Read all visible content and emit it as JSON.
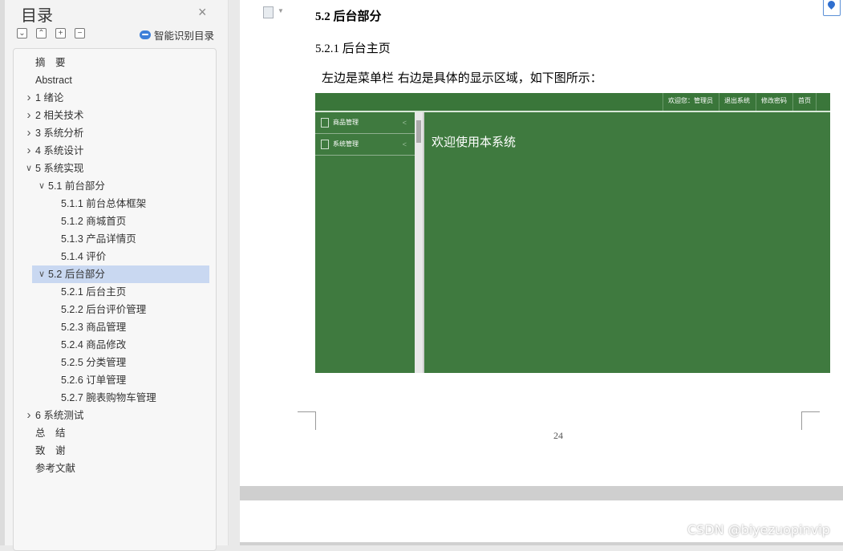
{
  "toc": {
    "title": "目录",
    "close": "×",
    "toolbar": {
      "collapse": "⌄",
      "expand": "⌃",
      "add": "+",
      "remove": "−"
    },
    "smart_label": "智能识别目录",
    "items": [
      {
        "label": "摘　要",
        "arrow": "",
        "level": 0
      },
      {
        "label": "Abstract",
        "arrow": "",
        "level": 0
      },
      {
        "label": "1 绪论",
        "arrow": ">",
        "level": 0
      },
      {
        "label": "2 相关技术",
        "arrow": ">",
        "level": 0
      },
      {
        "label": "3 系统分析",
        "arrow": ">",
        "level": 0
      },
      {
        "label": "4 系统设计",
        "arrow": ">",
        "level": 0
      },
      {
        "label": "5 系统实现",
        "arrow": "v",
        "level": 0
      },
      {
        "label": "5.1  前台部分",
        "arrow": "v",
        "level": 1
      },
      {
        "label": "5.1.1  前台总体框架",
        "arrow": "",
        "level": 2
      },
      {
        "label": "5.1.2  商城首页",
        "arrow": "",
        "level": 2
      },
      {
        "label": "5.1.3  产品详情页",
        "arrow": "",
        "level": 2
      },
      {
        "label": "5.1.4  评价",
        "arrow": "",
        "level": 2
      },
      {
        "label": "5.2  后台部分",
        "arrow": "v",
        "level": 1,
        "selected": true
      },
      {
        "label": "5.2.1  后台主页",
        "arrow": "",
        "level": 2
      },
      {
        "label": "5.2.2  后台评价管理",
        "arrow": "",
        "level": 2
      },
      {
        "label": "5.2.3  商品管理",
        "arrow": "",
        "level": 2
      },
      {
        "label": "5.2.4  商品修改",
        "arrow": "",
        "level": 2
      },
      {
        "label": "5.2.5  分类管理",
        "arrow": "",
        "level": 2
      },
      {
        "label": "5.2.6  订单管理",
        "arrow": "",
        "level": 2
      },
      {
        "label": "5.2.7  腕表购物车管理",
        "arrow": "",
        "level": 2
      },
      {
        "label": "6 系统测试",
        "arrow": ">",
        "level": 0
      },
      {
        "label": "总　结",
        "arrow": "",
        "level": 0
      },
      {
        "label": "致　谢",
        "arrow": "",
        "level": 0
      },
      {
        "label": "参考文献",
        "arrow": "",
        "level": 0
      }
    ]
  },
  "document": {
    "heading2": "5.2  后台部分",
    "heading3": "5.2.1  后台主页",
    "paragraph": "左边是菜单栏  右边是具体的显示区域，如下图所示：",
    "page_number": "24"
  },
  "screenshot": {
    "nav": [
      "欢迎您：管理员",
      "退出系统",
      "修改密码",
      "首页"
    ],
    "menu": [
      "商品管理",
      "系统管理"
    ],
    "welcome": "欢迎使用本系统",
    "colors": {
      "green": "#3f7a3f"
    }
  },
  "watermark": "CSDN @biyezuopinvip"
}
